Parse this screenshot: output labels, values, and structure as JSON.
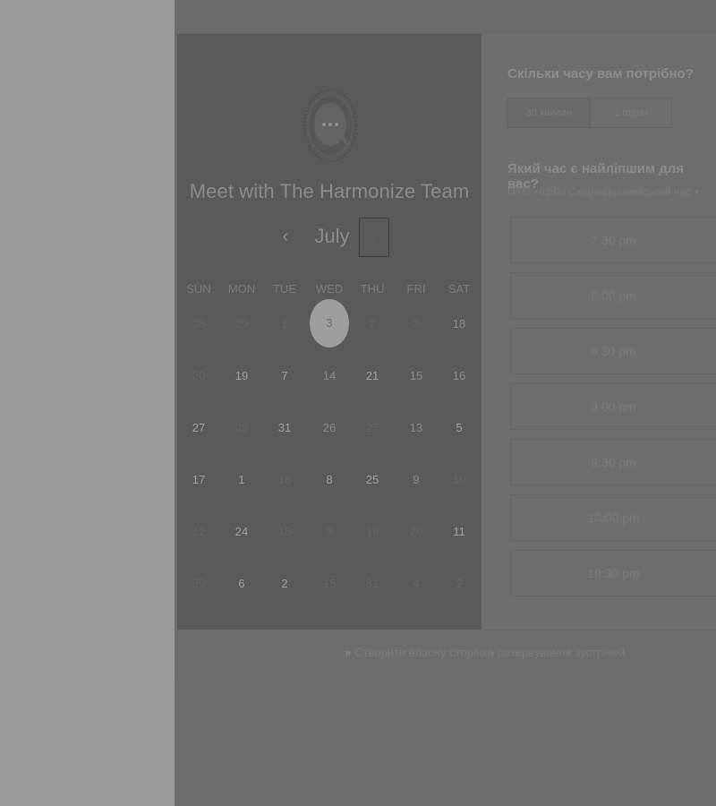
{
  "booking": {
    "team_name": "Meet with The Harmonize Team",
    "month_label": "July",
    "prev_icon": "‹",
    "next_icon": "›",
    "weekdays": [
      "SUN",
      "MON",
      "TUE",
      "WED",
      "THU",
      "FRI",
      "SAT"
    ],
    "weeks": [
      [
        "28",
        "29",
        "1",
        "3",
        "2",
        "3",
        "18"
      ],
      [
        "20",
        "19",
        "7",
        "14",
        "21",
        "15",
        "16"
      ],
      [
        "27",
        "28",
        "31",
        "26",
        "27",
        "13",
        "5"
      ],
      [
        "17",
        "1",
        "18",
        "8",
        "25",
        "9",
        "10"
      ],
      [
        "12",
        "24",
        "15",
        "9",
        "19",
        "20",
        "11"
      ],
      [
        "29",
        "6",
        "2",
        "15",
        "31",
        "4",
        "2"
      ]
    ],
    "selected_day": "3"
  },
  "duration": {
    "question": "Скільки часу вам потрібно?",
    "options": [
      "30 хвилин",
      "1 годин"
    ]
  },
  "time": {
    "question": "Який час є найліпшим для вас?",
    "timezone": "UTC +03:00 Східноєвропейський час",
    "slots": [
      "7:30 pm",
      "8:00 pm",
      "8:30 pm",
      "9:00 pm",
      "9:30 pm",
      "10:00 pm",
      "10:30 pm"
    ]
  },
  "footer": {
    "link_text": "Створити власну сторінка резервування зустрічей",
    "arrow_icon": "»"
  },
  "icons": {
    "logo": "chat-bubble-logo-icon",
    "caret": "caret-down-icon"
  }
}
